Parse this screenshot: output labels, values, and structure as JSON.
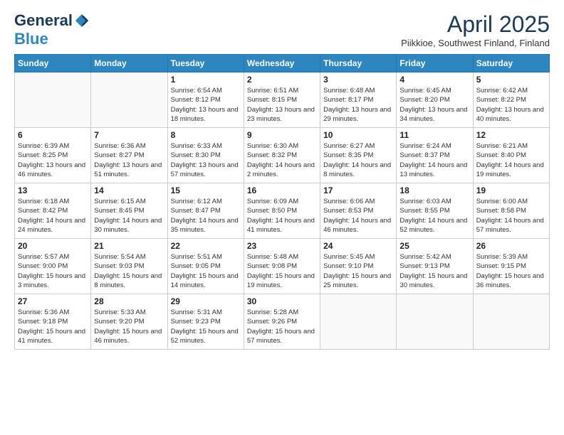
{
  "logo": {
    "general": "General",
    "blue": "Blue"
  },
  "title": "April 2025",
  "subtitle": "Piikkioe, Southwest Finland, Finland",
  "days_of_week": [
    "Sunday",
    "Monday",
    "Tuesday",
    "Wednesday",
    "Thursday",
    "Friday",
    "Saturday"
  ],
  "weeks": [
    [
      {
        "day": "",
        "info": ""
      },
      {
        "day": "",
        "info": ""
      },
      {
        "day": "1",
        "info": "Sunrise: 6:54 AM\nSunset: 8:12 PM\nDaylight: 13 hours and 18 minutes."
      },
      {
        "day": "2",
        "info": "Sunrise: 6:51 AM\nSunset: 8:15 PM\nDaylight: 13 hours and 23 minutes."
      },
      {
        "day": "3",
        "info": "Sunrise: 6:48 AM\nSunset: 8:17 PM\nDaylight: 13 hours and 29 minutes."
      },
      {
        "day": "4",
        "info": "Sunrise: 6:45 AM\nSunset: 8:20 PM\nDaylight: 13 hours and 34 minutes."
      },
      {
        "day": "5",
        "info": "Sunrise: 6:42 AM\nSunset: 8:22 PM\nDaylight: 13 hours and 40 minutes."
      }
    ],
    [
      {
        "day": "6",
        "info": "Sunrise: 6:39 AM\nSunset: 8:25 PM\nDaylight: 13 hours and 46 minutes."
      },
      {
        "day": "7",
        "info": "Sunrise: 6:36 AM\nSunset: 8:27 PM\nDaylight: 13 hours and 51 minutes."
      },
      {
        "day": "8",
        "info": "Sunrise: 6:33 AM\nSunset: 8:30 PM\nDaylight: 13 hours and 57 minutes."
      },
      {
        "day": "9",
        "info": "Sunrise: 6:30 AM\nSunset: 8:32 PM\nDaylight: 14 hours and 2 minutes."
      },
      {
        "day": "10",
        "info": "Sunrise: 6:27 AM\nSunset: 8:35 PM\nDaylight: 14 hours and 8 minutes."
      },
      {
        "day": "11",
        "info": "Sunrise: 6:24 AM\nSunset: 8:37 PM\nDaylight: 14 hours and 13 minutes."
      },
      {
        "day": "12",
        "info": "Sunrise: 6:21 AM\nSunset: 8:40 PM\nDaylight: 14 hours and 19 minutes."
      }
    ],
    [
      {
        "day": "13",
        "info": "Sunrise: 6:18 AM\nSunset: 8:42 PM\nDaylight: 14 hours and 24 minutes."
      },
      {
        "day": "14",
        "info": "Sunrise: 6:15 AM\nSunset: 8:45 PM\nDaylight: 14 hours and 30 minutes."
      },
      {
        "day": "15",
        "info": "Sunrise: 6:12 AM\nSunset: 8:47 PM\nDaylight: 14 hours and 35 minutes."
      },
      {
        "day": "16",
        "info": "Sunrise: 6:09 AM\nSunset: 8:50 PM\nDaylight: 14 hours and 41 minutes."
      },
      {
        "day": "17",
        "info": "Sunrise: 6:06 AM\nSunset: 8:53 PM\nDaylight: 14 hours and 46 minutes."
      },
      {
        "day": "18",
        "info": "Sunrise: 6:03 AM\nSunset: 8:55 PM\nDaylight: 14 hours and 52 minutes."
      },
      {
        "day": "19",
        "info": "Sunrise: 6:00 AM\nSunset: 8:58 PM\nDaylight: 14 hours and 57 minutes."
      }
    ],
    [
      {
        "day": "20",
        "info": "Sunrise: 5:57 AM\nSunset: 9:00 PM\nDaylight: 15 hours and 3 minutes."
      },
      {
        "day": "21",
        "info": "Sunrise: 5:54 AM\nSunset: 9:03 PM\nDaylight: 15 hours and 8 minutes."
      },
      {
        "day": "22",
        "info": "Sunrise: 5:51 AM\nSunset: 9:05 PM\nDaylight: 15 hours and 14 minutes."
      },
      {
        "day": "23",
        "info": "Sunrise: 5:48 AM\nSunset: 9:08 PM\nDaylight: 15 hours and 19 minutes."
      },
      {
        "day": "24",
        "info": "Sunrise: 5:45 AM\nSunset: 9:10 PM\nDaylight: 15 hours and 25 minutes."
      },
      {
        "day": "25",
        "info": "Sunrise: 5:42 AM\nSunset: 9:13 PM\nDaylight: 15 hours and 30 minutes."
      },
      {
        "day": "26",
        "info": "Sunrise: 5:39 AM\nSunset: 9:15 PM\nDaylight: 15 hours and 36 minutes."
      }
    ],
    [
      {
        "day": "27",
        "info": "Sunrise: 5:36 AM\nSunset: 9:18 PM\nDaylight: 15 hours and 41 minutes."
      },
      {
        "day": "28",
        "info": "Sunrise: 5:33 AM\nSunset: 9:20 PM\nDaylight: 15 hours and 46 minutes."
      },
      {
        "day": "29",
        "info": "Sunrise: 5:31 AM\nSunset: 9:23 PM\nDaylight: 15 hours and 52 minutes."
      },
      {
        "day": "30",
        "info": "Sunrise: 5:28 AM\nSunset: 9:26 PM\nDaylight: 15 hours and 57 minutes."
      },
      {
        "day": "",
        "info": ""
      },
      {
        "day": "",
        "info": ""
      },
      {
        "day": "",
        "info": ""
      }
    ]
  ]
}
